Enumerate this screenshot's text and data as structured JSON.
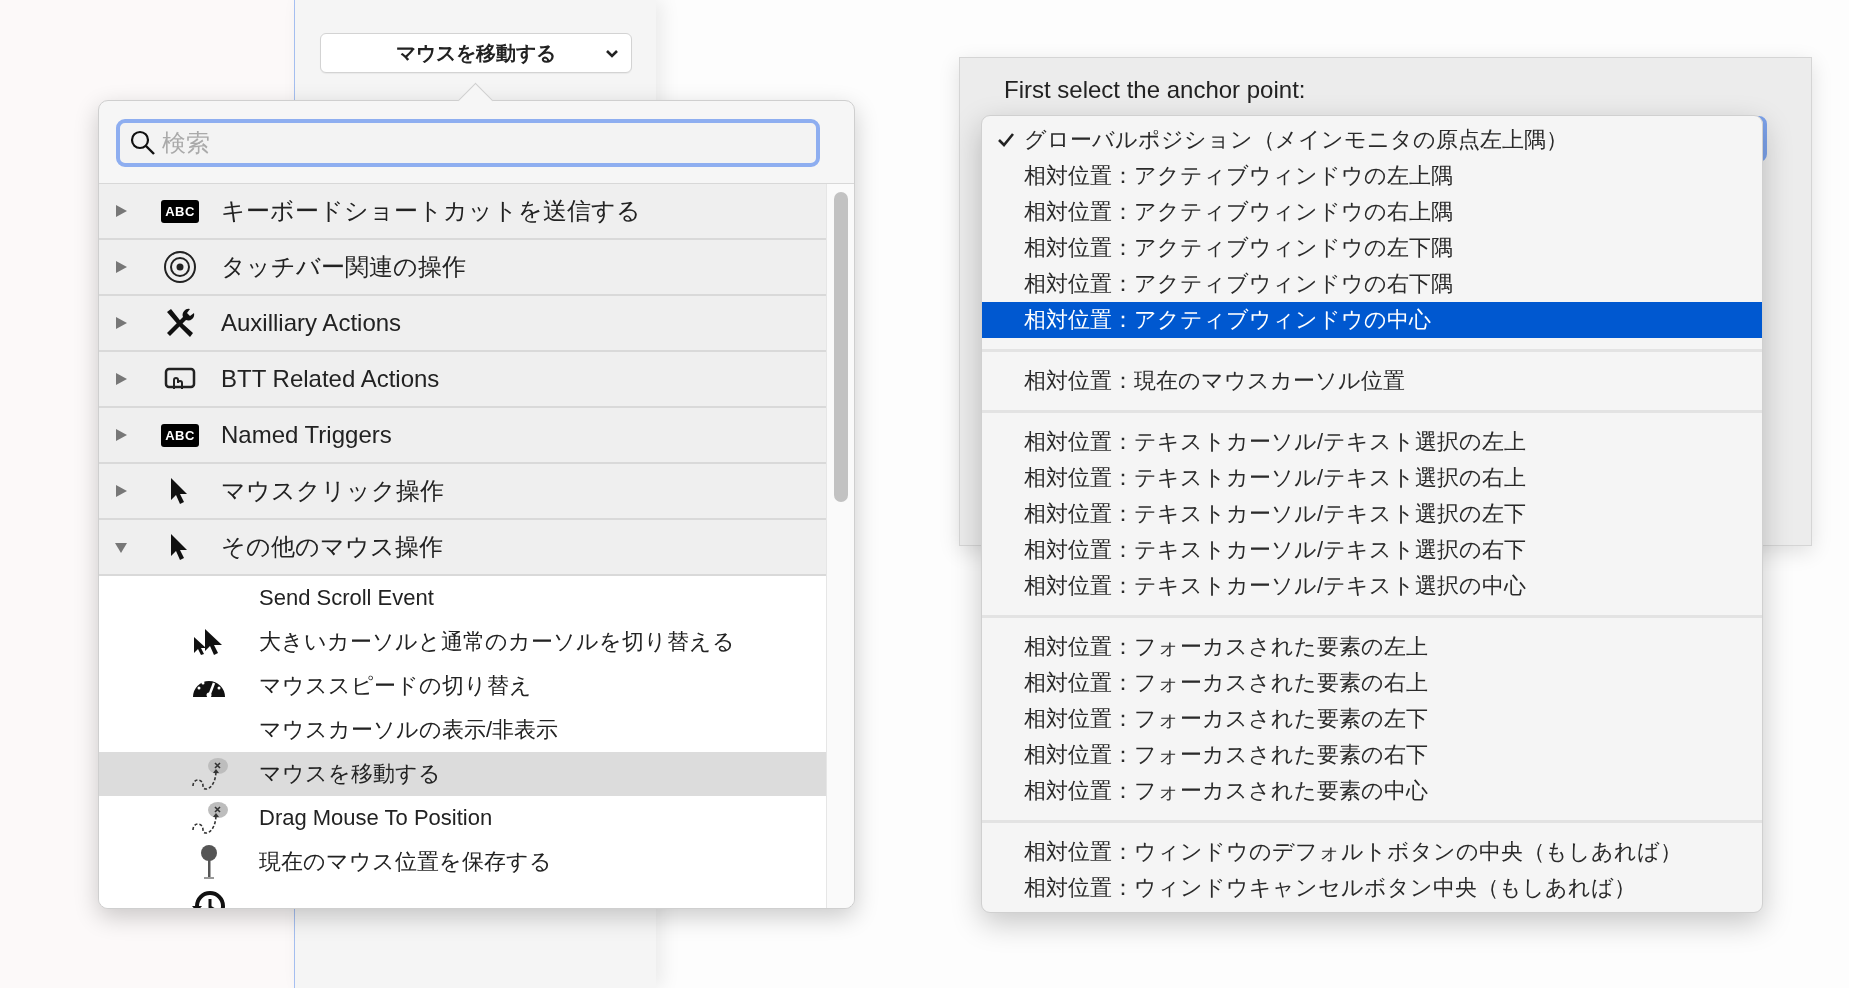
{
  "action_button": {
    "label": "マウスを移動する"
  },
  "search": {
    "placeholder": "検索"
  },
  "groups": [
    {
      "label": "キーボードショートカットを送信する",
      "badge": "ABC",
      "expanded": false
    },
    {
      "label": "タッチバー関連の操作",
      "expanded": false
    },
    {
      "label": "Auxilliary Actions",
      "expanded": false
    },
    {
      "label": "BTT Related Actions",
      "expanded": false
    },
    {
      "label": "Named Triggers",
      "badge": "ABC",
      "expanded": false
    },
    {
      "label": "マウスクリック操作",
      "expanded": false
    },
    {
      "label": "その他のマウス操作",
      "expanded": true,
      "children": [
        {
          "label": "Send Scroll Event",
          "selected": false
        },
        {
          "label": "大きいカーソルと通常のカーソルを切り替える",
          "selected": false
        },
        {
          "label": "マウススピードの切り替え",
          "selected": false
        },
        {
          "label": "マウスカーソルの表示/非表示",
          "selected": false
        },
        {
          "label": "マウスを移動する",
          "selected": true
        },
        {
          "label": "Drag Mouse To Position",
          "selected": false
        },
        {
          "label": "現在のマウス位置を保存する",
          "selected": false
        },
        {
          "selected": false
        }
      ]
    }
  ],
  "dialog": {
    "label": "First select the anchor point:"
  },
  "anchor_menu": {
    "sections": [
      [
        {
          "label": "グローバルポジション（メインモニタの原点左上隅）",
          "checked": true,
          "selected": false
        },
        {
          "label": "相対位置：アクティブウィンドウの左上隅",
          "checked": false,
          "selected": false
        },
        {
          "label": "相対位置：アクティブウィンドウの右上隅",
          "checked": false,
          "selected": false
        },
        {
          "label": "相対位置：アクティブウィンドウの左下隅",
          "checked": false,
          "selected": false
        },
        {
          "label": "相対位置：アクティブウィンドウの右下隅",
          "checked": false,
          "selected": false
        },
        {
          "label": "相対位置：アクティブウィンドウの中心",
          "checked": false,
          "selected": true
        }
      ],
      [
        {
          "label": "相対位置：現在のマウスカーソル位置",
          "checked": false,
          "selected": false
        }
      ],
      [
        {
          "label": "相対位置：テキストカーソル/テキスト選択の左上",
          "checked": false,
          "selected": false
        },
        {
          "label": "相対位置：テキストカーソル/テキスト選択の右上",
          "checked": false,
          "selected": false
        },
        {
          "label": "相対位置：テキストカーソル/テキスト選択の左下",
          "checked": false,
          "selected": false
        },
        {
          "label": "相対位置：テキストカーソル/テキスト選択の右下",
          "checked": false,
          "selected": false
        },
        {
          "label": "相対位置：テキストカーソル/テキスト選択の中心",
          "checked": false,
          "selected": false
        }
      ],
      [
        {
          "label": "相対位置：フォーカスされた要素の左上",
          "checked": false,
          "selected": false
        },
        {
          "label": "相対位置：フォーカスされた要素の右上",
          "checked": false,
          "selected": false
        },
        {
          "label": "相対位置：フォーカスされた要素の左下",
          "checked": false,
          "selected": false
        },
        {
          "label": "相対位置：フォーカスされた要素の右下",
          "checked": false,
          "selected": false
        },
        {
          "label": "相対位置：フォーカスされた要素の中心",
          "checked": false,
          "selected": false
        }
      ],
      [
        {
          "label": "相対位置：ウィンドウのデフォルトボタンの中央（もしあれば）",
          "checked": false,
          "selected": false
        },
        {
          "label": "相対位置：ウィンドウキャンセルボタン中央（もしあれば）",
          "checked": false,
          "selected": false
        }
      ]
    ]
  }
}
